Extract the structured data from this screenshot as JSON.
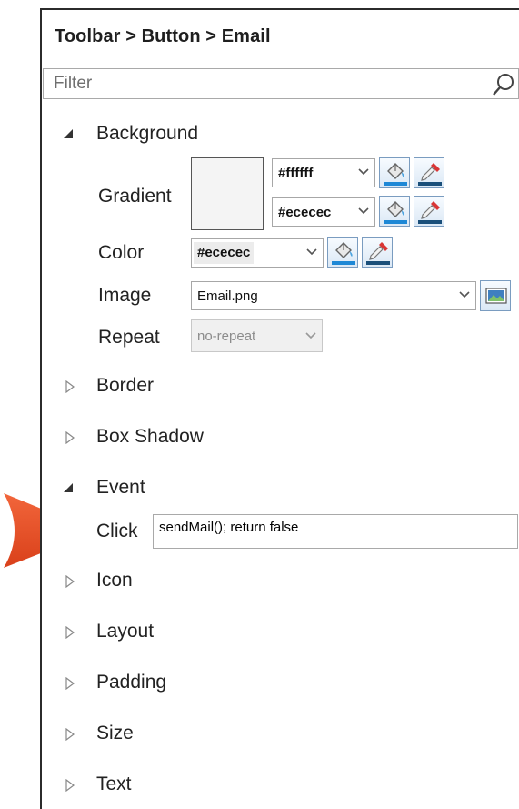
{
  "breadcrumb": "Toolbar > Button > Email",
  "filter": {
    "placeholder": "Filter",
    "value": ""
  },
  "sections": {
    "background": {
      "label": "Background",
      "expanded": true,
      "gradient": {
        "label": "Gradient",
        "color1": "#ffffff",
        "color2": "#ececec"
      },
      "color": {
        "label": "Color",
        "value": "#ececec"
      },
      "image": {
        "label": "Image",
        "value": "Email.png"
      },
      "repeat": {
        "label": "Repeat",
        "value": "no-repeat"
      }
    },
    "border": {
      "label": "Border",
      "expanded": false
    },
    "box_shadow": {
      "label": "Box Shadow",
      "expanded": false
    },
    "event": {
      "label": "Event",
      "expanded": true,
      "click": {
        "label": "Click",
        "value": "sendMail(); return false"
      }
    },
    "icon": {
      "label": "Icon",
      "expanded": false
    },
    "layout": {
      "label": "Layout",
      "expanded": false
    },
    "padding": {
      "label": "Padding",
      "expanded": false
    },
    "size": {
      "label": "Size",
      "expanded": false
    },
    "text": {
      "label": "Text",
      "expanded": false
    }
  },
  "colors": {
    "callout_arrow": "#e5461f",
    "button_border": "#7a9cc0",
    "pin": "#d93636",
    "bucket_paint": "#1e88d6"
  },
  "icons": {
    "search": "search-icon",
    "paint_bucket": "paint-bucket-icon",
    "color_picker": "color-picker-icon",
    "image_browse": "image-browse-icon"
  }
}
